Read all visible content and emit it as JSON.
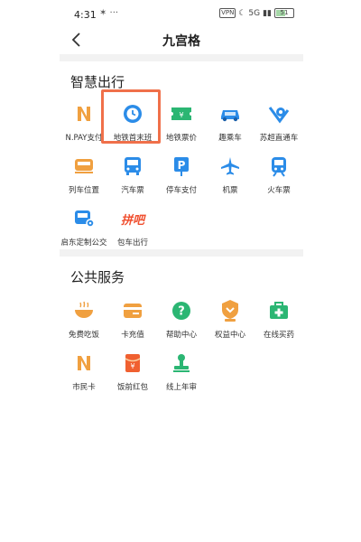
{
  "status": {
    "time": "4:31",
    "left_icons": "✶ ···",
    "vpn": "VPN",
    "signal": "5G",
    "battery": "51"
  },
  "nav": {
    "title": "九宫格",
    "back_icon": "chevron-left-icon"
  },
  "sections": [
    {
      "title": "智慧出行",
      "items": [
        {
          "label": "N.PAY支付",
          "icon": "npay-icon",
          "color": "#f0a040"
        },
        {
          "label": "地铁首末班",
          "icon": "clock-icon",
          "color": "#2b8ce8"
        },
        {
          "label": "地铁票价",
          "icon": "ticket-icon",
          "color": "#2bb673"
        },
        {
          "label": "趣乘车",
          "icon": "car-icon",
          "color": "#2b8ce8"
        },
        {
          "label": "苏超直通车",
          "icon": "soccer-icon",
          "color": "#2b8ce8"
        },
        {
          "label": "列车位置",
          "icon": "train-icon",
          "color": "#f0a040"
        },
        {
          "label": "汽车票",
          "icon": "bus-icon",
          "color": "#2b8ce8"
        },
        {
          "label": "停车支付",
          "icon": "parking-icon",
          "color": "#2b8ce8"
        },
        {
          "label": "机票",
          "icon": "plane-icon",
          "color": "#2b8ce8"
        },
        {
          "label": "火车票",
          "icon": "train-ticket-icon",
          "color": "#2b8ce8"
        },
        {
          "label": "启东定制公交",
          "icon": "custom-bus-icon",
          "color": "#2b8ce8"
        },
        {
          "label": "包车出行",
          "icon": "charter-icon",
          "color": "#f05030",
          "text": "拼吧"
        }
      ]
    },
    {
      "title": "公共服务",
      "items": [
        {
          "label": "免费吃饭",
          "icon": "bowl-icon",
          "color": "#f0a040"
        },
        {
          "label": "卡充值",
          "icon": "card-recharge-icon",
          "color": "#f0a040"
        },
        {
          "label": "帮助中心",
          "icon": "help-icon",
          "color": "#2bb673"
        },
        {
          "label": "权益中心",
          "icon": "benefit-icon",
          "color": "#f0a040"
        },
        {
          "label": "在线买药",
          "icon": "medicine-icon",
          "color": "#2bb673"
        },
        {
          "label": "市民卡",
          "icon": "citizen-card-icon",
          "color": "#f0a040"
        },
        {
          "label": "饭前红包",
          "icon": "red-packet-icon",
          "color": "#f06030"
        },
        {
          "label": "线上年审",
          "icon": "annual-review-icon",
          "color": "#2bb673"
        }
      ]
    }
  ]
}
